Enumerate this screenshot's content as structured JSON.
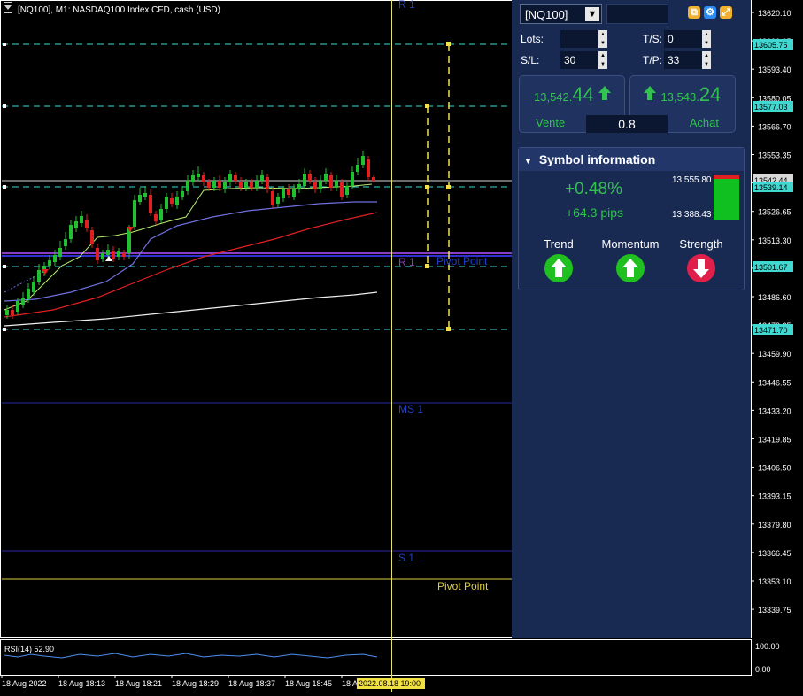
{
  "chart": {
    "title": "[NQ100], M1:  NASDAQ100 Index CFD, cash (USD)",
    "price_ticks": [
      "13620.10",
      "13606.85",
      "13593.40",
      "13580.05",
      "13566.70",
      "13553.35",
      "13540.00",
      "13526.65",
      "13513.30",
      "13499.95",
      "13486.60",
      "13473.25",
      "13459.90",
      "13446.55",
      "13433.20",
      "13419.85",
      "13406.50",
      "13393.15",
      "13379.80",
      "13366.45",
      "13353.10",
      "13339.75"
    ],
    "price_labels": [
      {
        "text": "13605.75",
        "color": "#3fd9d2"
      },
      {
        "text": "13577.03",
        "color": "#3fd9d2"
      },
      {
        "text": "13542.44",
        "color": "#d8d8d8"
      },
      {
        "text": "13539.14",
        "color": "#3fd9d2"
      },
      {
        "text": "13501.67",
        "color": "#3fd9d2"
      },
      {
        "text": "13471.70",
        "color": "#3fd9d2"
      }
    ],
    "levels": {
      "r1_top": "R 1",
      "r1": "R 1",
      "pivot_point_blue": "Pivot Point",
      "ms1": "MS 1",
      "s1": "S 1",
      "pivot_point_yellow": "Pivot Point"
    },
    "time_labels": [
      "18 Aug 2022",
      "18 Aug 18:13",
      "18 Aug 18:21",
      "18 Aug 18:29",
      "18 Aug 18:37",
      "18 Aug 18:45",
      "18 A"
    ],
    "cursor_time": "2022.08.18 19:00",
    "rsi": {
      "label": "RSI(14) 52.90",
      "ticks": [
        "100.00",
        "0.00"
      ]
    }
  },
  "panel": {
    "symbol": "[NQ100]",
    "lots_label": "Lots:",
    "lots_value": "",
    "ts_label": "T/S:",
    "ts_value": "0",
    "sl_label": "S/L:",
    "sl_value": "30",
    "tp_label": "T/P:",
    "tp_value": "33",
    "sell": {
      "prefix": "13,542.",
      "suffix": "44",
      "caption": "Vente"
    },
    "buy": {
      "prefix": "13,543.",
      "suffix": "24",
      "caption": "Achat"
    },
    "spread": "0.8",
    "info": {
      "header": "Symbol information",
      "pct": "+0.48%",
      "pips": "+64.3 pips",
      "high": "13,555.80",
      "low": "13,388.43",
      "trend": "Trend",
      "momentum": "Momentum",
      "strength": "Strength"
    }
  },
  "colors": {
    "panel_bg": "#192a52",
    "green": "#31c24f",
    "red": "#e02040",
    "cyan": "#3fd9d2",
    "yellow": "#f0e050"
  }
}
